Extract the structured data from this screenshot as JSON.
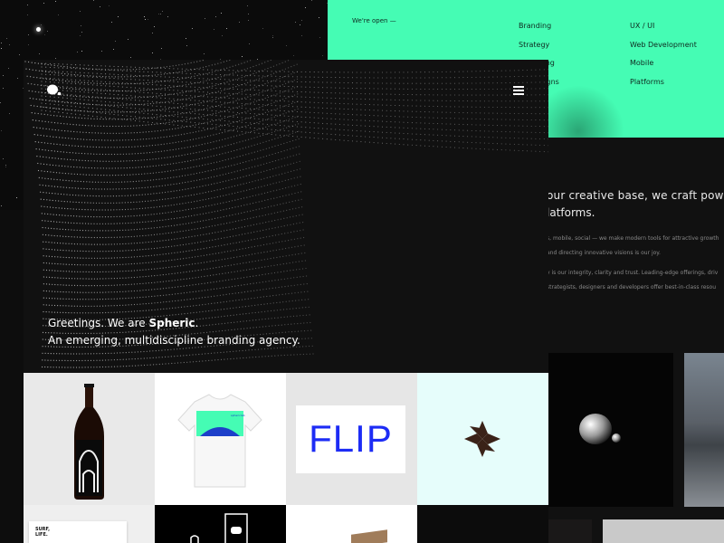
{
  "menu": {
    "open_label": "We're open —",
    "col1": [
      "Branding",
      "Strategy",
      "Marketing",
      "Campaigns"
    ],
    "col2": [
      "UX / UI",
      "Web Development",
      "Mobile",
      "Platforms"
    ]
  },
  "about": {
    "tagline_1": "our creative base, we craft powerfu",
    "tagline_2": "latforms.",
    "para_1_line_1": "s, mobile, social — we make modern tools for attractive growth",
    "para_1_line_2": "and directing innovative visions is our joy.",
    "para_2_line_1": "y is our integrity, clarity and trust. Leading-edge offerings, driv",
    "para_2_line_2": "strategists, designers and developers offer best-in-class resou"
  },
  "hero": {
    "greeting_prefix": "Greetings. We are ",
    "brand": "Spheric",
    "greeting_suffix": ".",
    "subtitle": "An emerging, multidiscipline branding agency."
  },
  "work": {
    "flip_label": "FLIP",
    "tshirt_label": "sphericlab",
    "booklet_line_1": "SURF,",
    "booklet_line_2": "LIFE."
  },
  "colors": {
    "accent": "#45fcb4",
    "flip_blue": "#1d2cf5",
    "mint_tile": "#e6fdfb"
  }
}
